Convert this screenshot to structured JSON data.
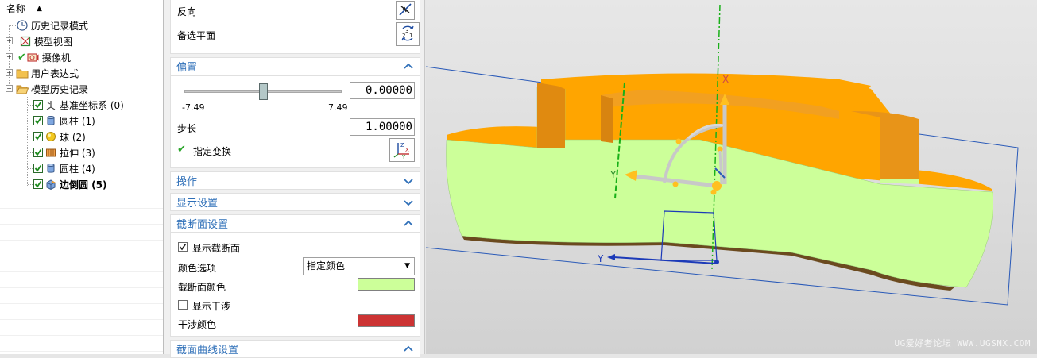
{
  "navigator": {
    "header": "名称",
    "nodes": [
      {
        "label": "历史记录模式",
        "icon": "clock-icon"
      },
      {
        "label": "模型视图",
        "icon": "model-view-icon"
      },
      {
        "label": "摄像机",
        "icon": "camera-icon"
      },
      {
        "label": "用户表达式",
        "icon": "folder-icon"
      },
      {
        "label": "模型历史记录",
        "icon": "folder-open-icon"
      },
      {
        "label": "基准坐标系 (0)",
        "icon": "datum-csys-icon"
      },
      {
        "label": "圆柱 (1)",
        "icon": "cylinder-icon"
      },
      {
        "label": "球 (2)",
        "icon": "sphere-icon"
      },
      {
        "label": "拉伸 (3)",
        "icon": "extrude-icon"
      },
      {
        "label": "圆柱 (4)",
        "icon": "cylinder-icon"
      },
      {
        "label": "边倒圆 (5)",
        "icon": "edge-blend-icon"
      }
    ]
  },
  "dialog": {
    "reverse_label": "反向",
    "alt_plane_label": "备选平面",
    "offset": {
      "title": "偏置",
      "value": "0.00000",
      "min_label": "-7.49",
      "max_label": "7.49",
      "slider_fraction": 0.5,
      "step_label": "步长",
      "step_value": "1.00000",
      "specify_transform": "指定变换"
    },
    "operations_title": "操作",
    "display_title": "显示设置",
    "section_settings": {
      "title": "截断面设置",
      "show_section": "显示截断面",
      "color_option_label": "颜色选项",
      "color_option_value": "指定颜色",
      "section_color_label": "截断面颜色",
      "section_color": "#ccff99",
      "show_interference": "显示干涉",
      "interference_color_label": "干涉颜色",
      "interference_color": "#cc3333"
    },
    "curve_settings_title": "截面曲线设置"
  },
  "viewport": {
    "axis_x": "X",
    "axis_y": "Y",
    "axis_y2": "Y",
    "watermark": "UG爱好者论坛 WWW.UGSNX.COM"
  },
  "colors": {
    "accent_blue": "#2e6fb8",
    "section_green": "#ccff99",
    "body_orange": "#ffa500",
    "check_green": "#2aa52a"
  }
}
